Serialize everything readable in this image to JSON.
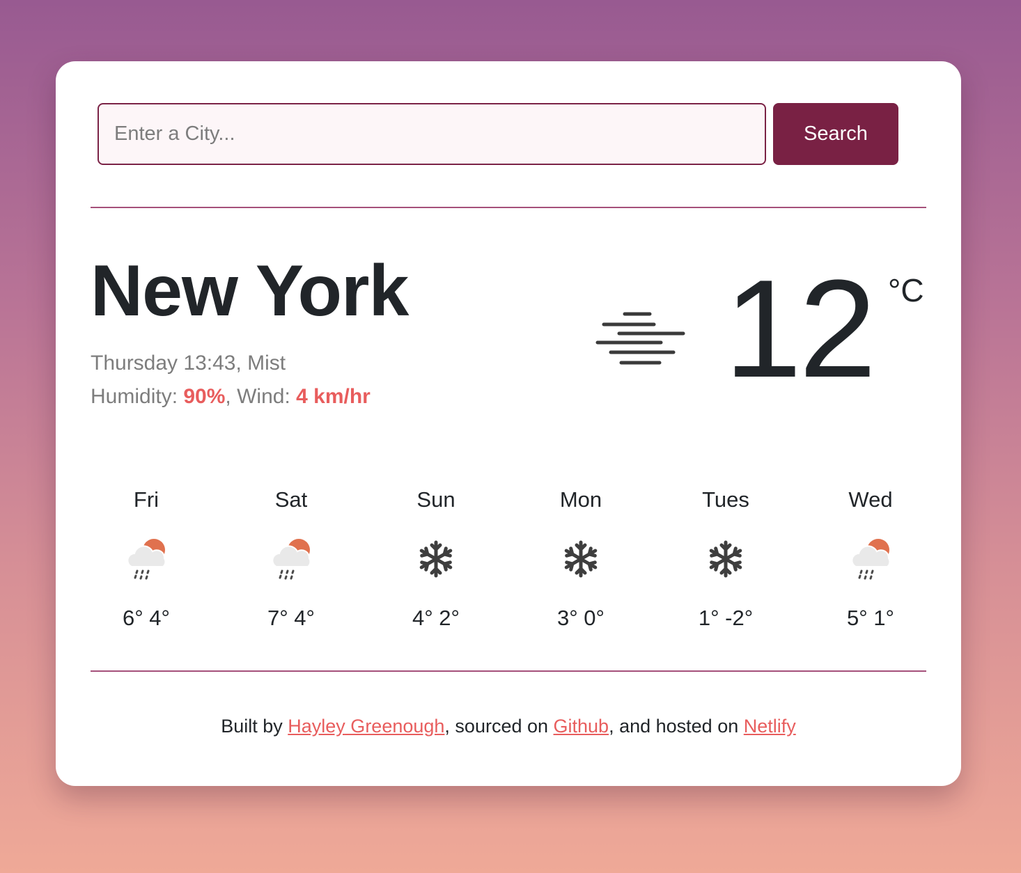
{
  "search": {
    "placeholder": "Enter a City...",
    "button_label": "Search"
  },
  "current": {
    "city": "New York",
    "day_time": "Thursday 13:43",
    "description": "Mist",
    "humidity_label": "Humidity:",
    "humidity_value": "90%",
    "wind_label": "Wind:",
    "wind_value": "4 km/hr",
    "temperature": "12",
    "unit": "°C",
    "icon": "mist-icon"
  },
  "forecast": [
    {
      "day": "Fri",
      "temps": "6° 4°",
      "icon": "sun-cloud-rain-icon"
    },
    {
      "day": "Sat",
      "temps": "7° 4°",
      "icon": "sun-cloud-rain-icon"
    },
    {
      "day": "Sun",
      "temps": "4° 2°",
      "icon": "snowflake-icon"
    },
    {
      "day": "Mon",
      "temps": "3° 0°",
      "icon": "snowflake-icon"
    },
    {
      "day": "Tues",
      "temps": "1° -2°",
      "icon": "snowflake-icon"
    },
    {
      "day": "Wed",
      "temps": "5° 1°",
      "icon": "sun-cloud-rain-icon"
    }
  ],
  "footer": {
    "prefix": "Built by ",
    "author": "Hayley Greenough",
    "middle1": ", sourced on ",
    "source": "Github",
    "middle2": ", and hosted on ",
    "host": "Netlify"
  },
  "colors": {
    "accent": "#792144",
    "highlight": "#e85d5d",
    "text": "#212529",
    "muted": "#7d7d7d",
    "sun": "#e0714e"
  }
}
